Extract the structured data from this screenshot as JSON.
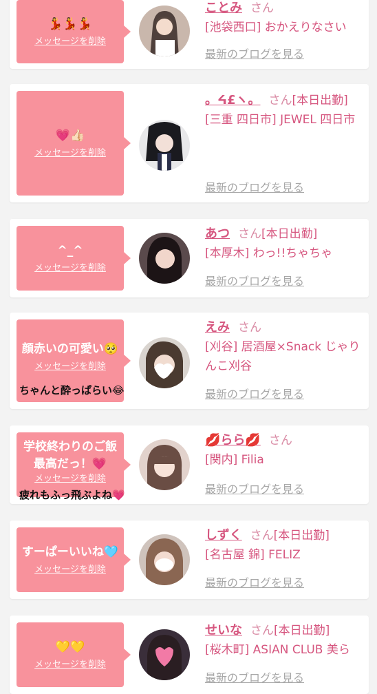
{
  "delete_label": "メッセージを削除",
  "suffix": "さん",
  "blog_label": "最新のブログを見る",
  "colors": {
    "bubble": "#f8929c",
    "name": "#d6567f",
    "blog_link": "#a8a8a8",
    "background": "#f3f3f3"
  },
  "cards": [
    {
      "message": "💃💃💃",
      "overflow": "",
      "name": "ことみ",
      "status": "",
      "shop": "[池袋西口] おかえりなさい"
    },
    {
      "message": "💗👍🏻",
      "overflow": "",
      "name": "。ᔦ£ヽ。",
      "status": "[本日出勤]",
      "shop": "[三重 四日市] JEWEL 四日市"
    },
    {
      "message": "^_^",
      "overflow": "",
      "name": "あつ",
      "status": "[本日出勤]",
      "shop": "[本厚木] わっ!!ちゃちゃ"
    },
    {
      "message": "顔赤いの可愛い🥺",
      "overflow": "ちゃんと酔っぱらい😂",
      "name": "えみ",
      "status": "",
      "shop": "[刈谷] 居酒屋×Snack じゃりんこ刈谷"
    },
    {
      "message": "学校終わりのご飯最高だっ！💗",
      "overflow": "疲れもふっ飛ぶよね💗",
      "name": "💋らら💋",
      "status": "",
      "shop": "[関内] Filia"
    },
    {
      "message": "すーぱーいいね🩵",
      "overflow": "",
      "name": "しずく",
      "status": "[本日出勤]",
      "shop": "[名古屋 錦] FELIZ"
    },
    {
      "message": "💛💛",
      "overflow": "",
      "name": "せいな",
      "status": "[本日出勤]",
      "shop": "[桜木町] ASIAN CLUB 美ら"
    }
  ]
}
